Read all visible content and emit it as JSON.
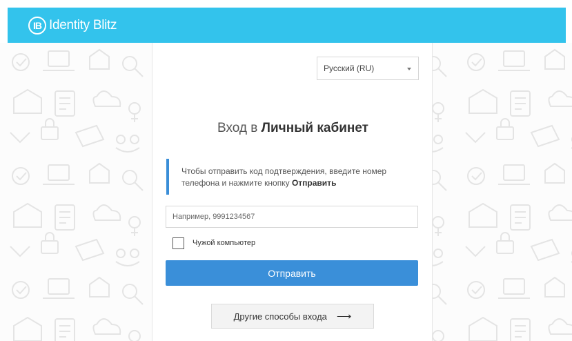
{
  "brand": {
    "logo_mark": "IB",
    "name": "Identity Blitz",
    "color": "#33c3ec"
  },
  "language": {
    "selected": "Русский (RU)"
  },
  "title": {
    "prefix": "Вход в",
    "emphasis": "Личный кабинет"
  },
  "info": {
    "text": "Чтобы отправить код подтверждения, введите номер телефона и нажмите кнопку",
    "button_ref": "Отправить",
    "accent_color": "#3a8ed8"
  },
  "phone": {
    "placeholder": "Например, 9991234567",
    "value": ""
  },
  "foreign_computer": {
    "label": "Чужой компьютер",
    "checked": false
  },
  "submit": {
    "label": "Отправить",
    "color": "#3a8fd9"
  },
  "other_methods": {
    "label": "Другие способы входа",
    "icon": "arrow-right-icon"
  }
}
